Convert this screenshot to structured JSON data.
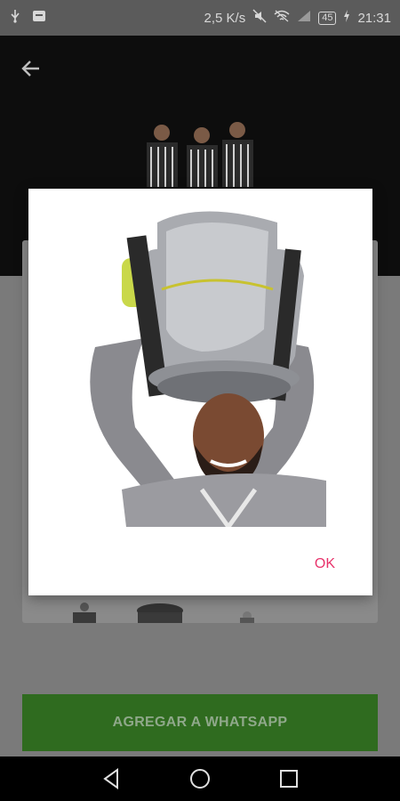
{
  "status_bar": {
    "speed": "2,5 K/s",
    "battery": "45",
    "time": "21:31"
  },
  "actions": {
    "add_to_whatsapp": "AGREGAR A WHATSAPP"
  },
  "dialog": {
    "ok_label": "OK"
  },
  "colors": {
    "accent_pink": "#e8336b",
    "whatsapp_green": "#2f6b1f"
  }
}
